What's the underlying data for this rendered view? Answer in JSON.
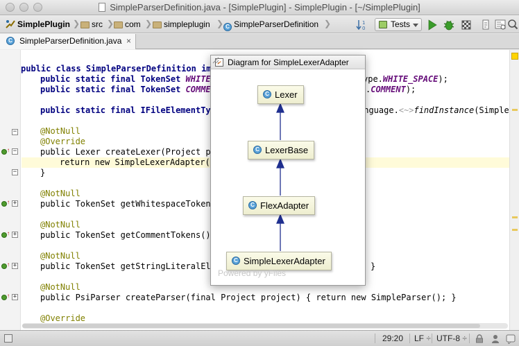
{
  "window": {
    "title": "SimpleParserDefinition.java - [SimplePlugin] - SimplePlugin - [~/SimplePlugin]"
  },
  "navbar": {
    "breadcrumbs": [
      "SimplePlugin",
      "src",
      "com",
      "simpleplugin",
      "SimpleParserDefinition"
    ],
    "run_config": "Tests"
  },
  "tab": {
    "label": "SimpleParserDefinition.java",
    "close": "×"
  },
  "code": {
    "l1": "public class SimpleParserDefinition imp",
    "l2a": "public static final TokenSet ",
    "l2b": "WHITE_",
    "l2c": "ype.",
    "l2d": "WHITE_SPACE",
    "l2e": ");",
    "l3a": "public static final TokenSet ",
    "l3b": "COMMEN",
    "l3c": ".",
    "l3d": "COMMENT",
    "l3e": ");",
    "l4a": "public static final IFileElementTyp",
    "l4b": "anguage.",
    "l4c": "<~>",
    "l4d": "findInstance",
    "l4e": "(Simple",
    "l5": "@NotNull",
    "l6": "@Override",
    "l7": "public Lexer createLexer(Project pr",
    "l8": "return new SimpleLexerAdapter()",
    "l9": "}",
    "l10": "@NotNull",
    "l11": "public TokenSet getWhitespaceTokens",
    "l12": "@NotNull",
    "l13a": "public TokenSet getCommentTokens()",
    "l14": "@NotNull",
    "l15a": "public TokenSet getStringLiteralEle",
    "l15b": "}",
    "l16": "@NotNull",
    "l17": "public PsiParser createParser(final Project project) { return new SimpleParser(); }",
    "l18": "@Override"
  },
  "diagram": {
    "title": "Diagram for SimpleLexerAdapter",
    "nodes": [
      "Lexer",
      "LexerBase",
      "FlexAdapter",
      "SimpleLexerAdapter"
    ],
    "watermark": "Powered by yFiles"
  },
  "status": {
    "position": "29:20",
    "line_separator": "LF",
    "line_separator_arrow": "÷",
    "encoding": "UTF-8",
    "encoding_arrow": "÷"
  },
  "icons": {
    "class": "C"
  },
  "colors": {
    "keyword": "#000080",
    "annotation": "#808000",
    "constant": "#660e7a",
    "current_line": "#fffbd9",
    "uml_arrow": "#1f2f8f"
  }
}
